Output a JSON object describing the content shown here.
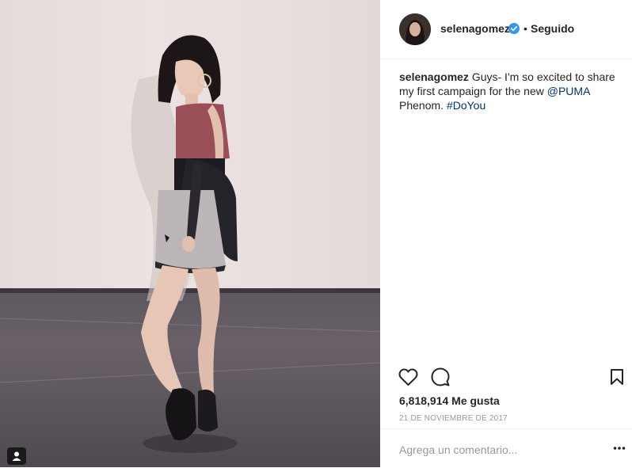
{
  "post": {
    "username": "selenagomez",
    "dot": "•",
    "follow_status": "Seguido"
  },
  "caption": {
    "username": "selenagomez",
    "text_before": "Guys- I'm so excited to share my first campaign for the new ",
    "mention": "@PUMA",
    "text_middle": " Phenom. ",
    "hashtag": "#DoYou"
  },
  "stats": {
    "likes": "6,818,914 Me gusta",
    "date": "21 DE NOVIEMBRE DE 2017"
  },
  "comment": {
    "placeholder": "Agrega un comentario..."
  },
  "icons": {
    "like": "heart-icon",
    "comment": "comment-bubble-icon",
    "save": "bookmark-icon",
    "more": "more-options-icon",
    "verified": "verified-badge-icon",
    "user_tag": "user-tag-icon"
  },
  "colors": {
    "link": "#003569",
    "verified": "#3897f0",
    "muted": "#999999",
    "text": "#262626"
  }
}
